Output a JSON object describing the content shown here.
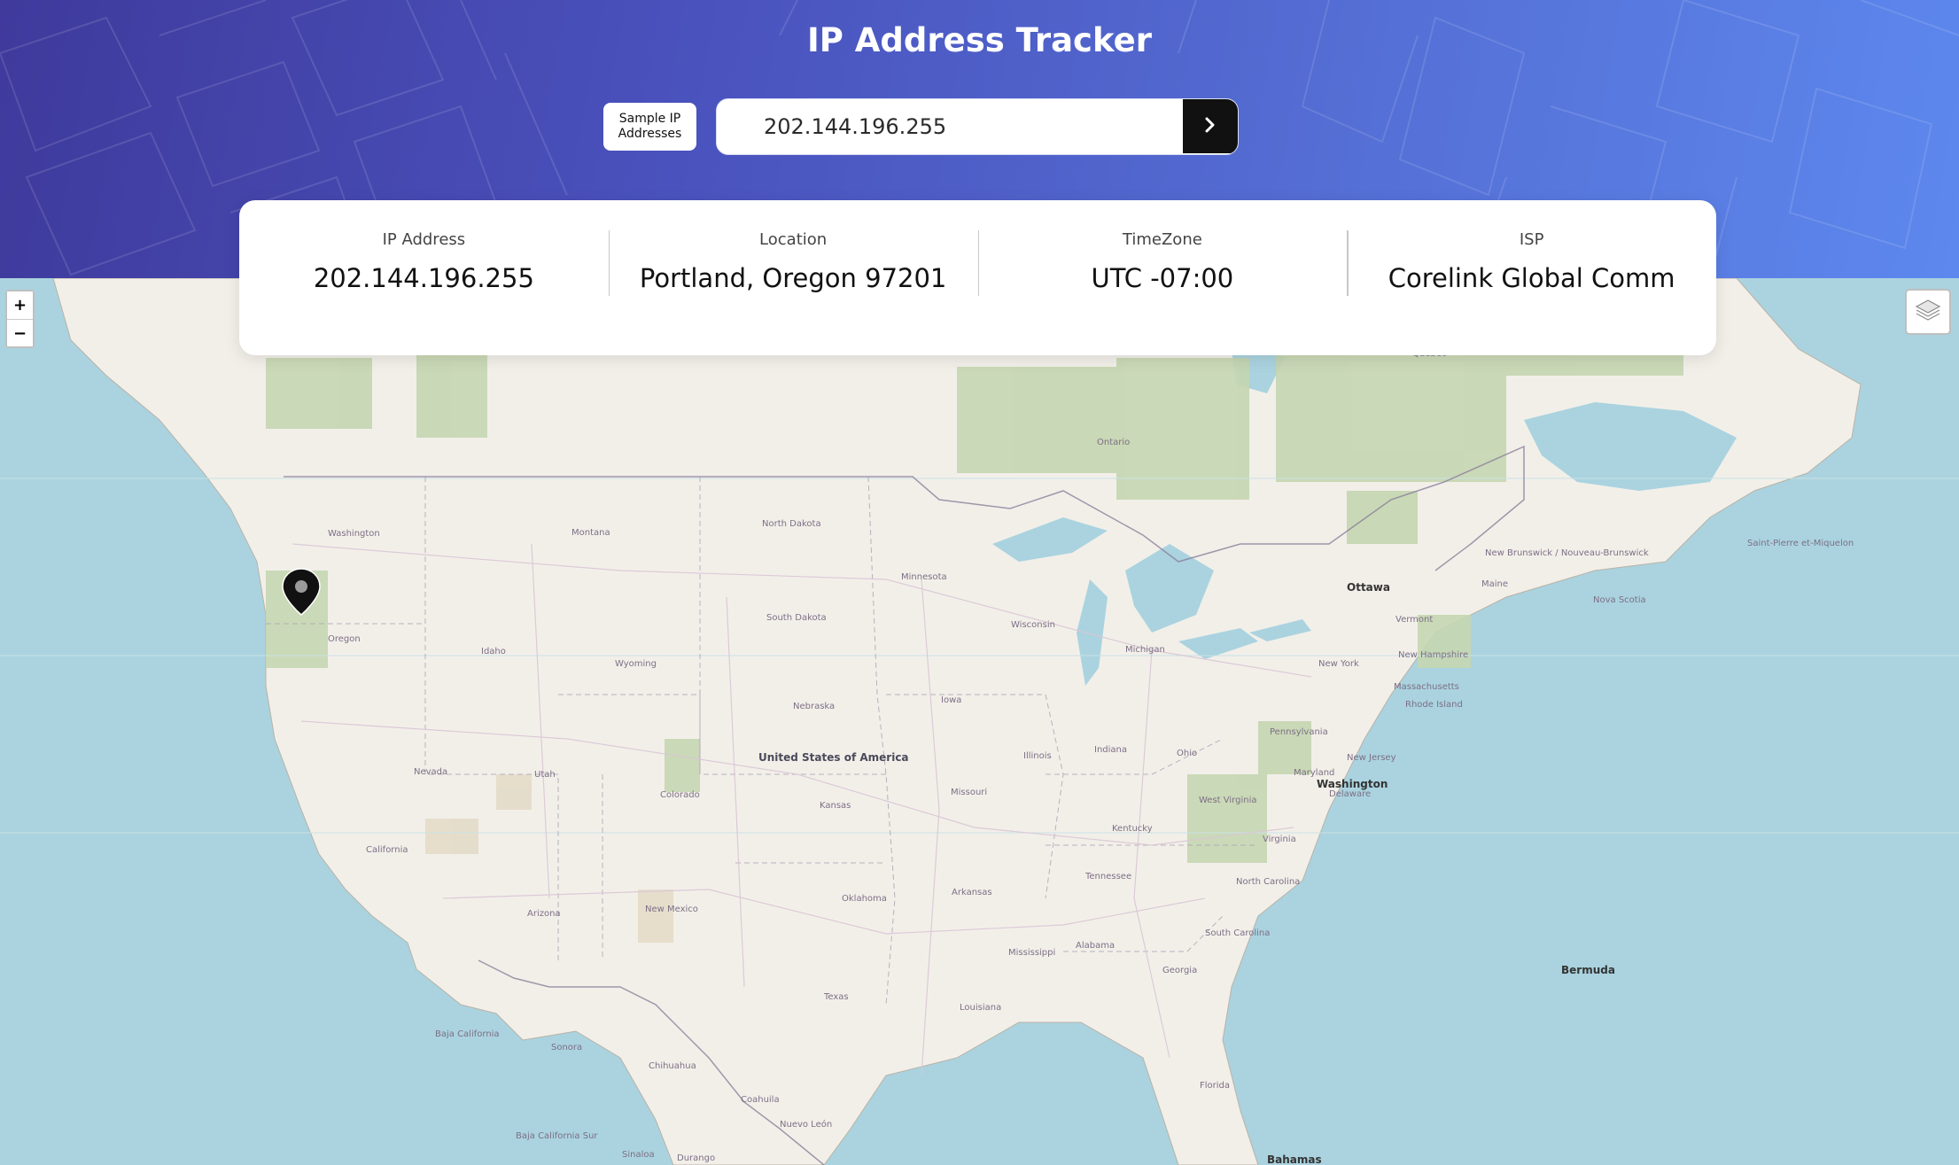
{
  "header": {
    "title": "IP Address Tracker",
    "sample_button_label": "Sample IP Addresses",
    "search_value": "202.144.196.255",
    "search_button_icon": "chevron-right-icon"
  },
  "info": {
    "ip_label": "IP Address",
    "ip_value": "202.144.196.255",
    "location_label": "Location",
    "location_value": "Portland, Oregon 97201",
    "timezone_label": "TimeZone",
    "timezone_value": "UTC -07:00",
    "isp_label": "ISP",
    "isp_value": "Corelink Global Comm"
  },
  "map": {
    "zoom_in_label": "+",
    "zoom_out_label": "−",
    "layers_icon": "layers-icon",
    "marker_icon": "map-pin-icon",
    "labels": {
      "usa": "United States of America",
      "ottawa": "Ottawa",
      "washington_dc": "Washington",
      "bermuda": "Bermuda",
      "bahamas": "Bahamas",
      "washington": "Washington",
      "oregon": "Oregon",
      "idaho": "Idaho",
      "montana": "Montana",
      "wyoming": "Wyoming",
      "nevada": "Nevada",
      "utah": "Utah",
      "colorado": "Colorado",
      "california": "California",
      "arizona": "Arizona",
      "new_mexico": "New Mexico",
      "north_dakota": "North Dakota",
      "south_dakota": "South Dakota",
      "nebraska": "Nebraska",
      "kansas": "Kansas",
      "oklahoma": "Oklahoma",
      "texas": "Texas",
      "minnesota": "Minnesota",
      "iowa": "Iowa",
      "missouri": "Missouri",
      "arkansas": "Arkansas",
      "louisiana": "Louisiana",
      "wisconsin": "Wisconsin",
      "illinois": "Illinois",
      "michigan": "Michigan",
      "indiana": "Indiana",
      "ohio": "Ohio",
      "kentucky": "Kentucky",
      "tennessee": "Tennessee",
      "mississippi": "Mississippi",
      "alabama": "Alabama",
      "georgia": "Georgia",
      "florida": "Florida",
      "south_carolina": "South Carolina",
      "north_carolina": "North Carolina",
      "virginia": "Virginia",
      "west_virginia": "West Virginia",
      "pennsylvania": "Pennsylvania",
      "new_york": "New York",
      "new_jersey": "New Jersey",
      "maryland": "Maryland",
      "delaware": "Delaware",
      "massachusetts": "Massachusetts",
      "rhode_island": "Rhode Island",
      "new_hampshire": "New Hampshire",
      "vermont": "Vermont",
      "maine": "Maine",
      "ontario": "Ontario",
      "quebec": "Québec",
      "new_brunswick": "New Brunswick / Nouveau-Brunswick",
      "nova_scotia": "Nova Scotia",
      "saint_pierre": "Saint-Pierre et-Miquelon",
      "baja_california": "Baja California",
      "baja_california_sur": "Baja California Sur",
      "sonora": "Sonora",
      "chihuahua": "Chihuahua",
      "coahuila": "Coahuila",
      "nuevo_leon": "Nuevo León",
      "sinaloa": "Sinaloa",
      "durango": "Durango"
    }
  }
}
